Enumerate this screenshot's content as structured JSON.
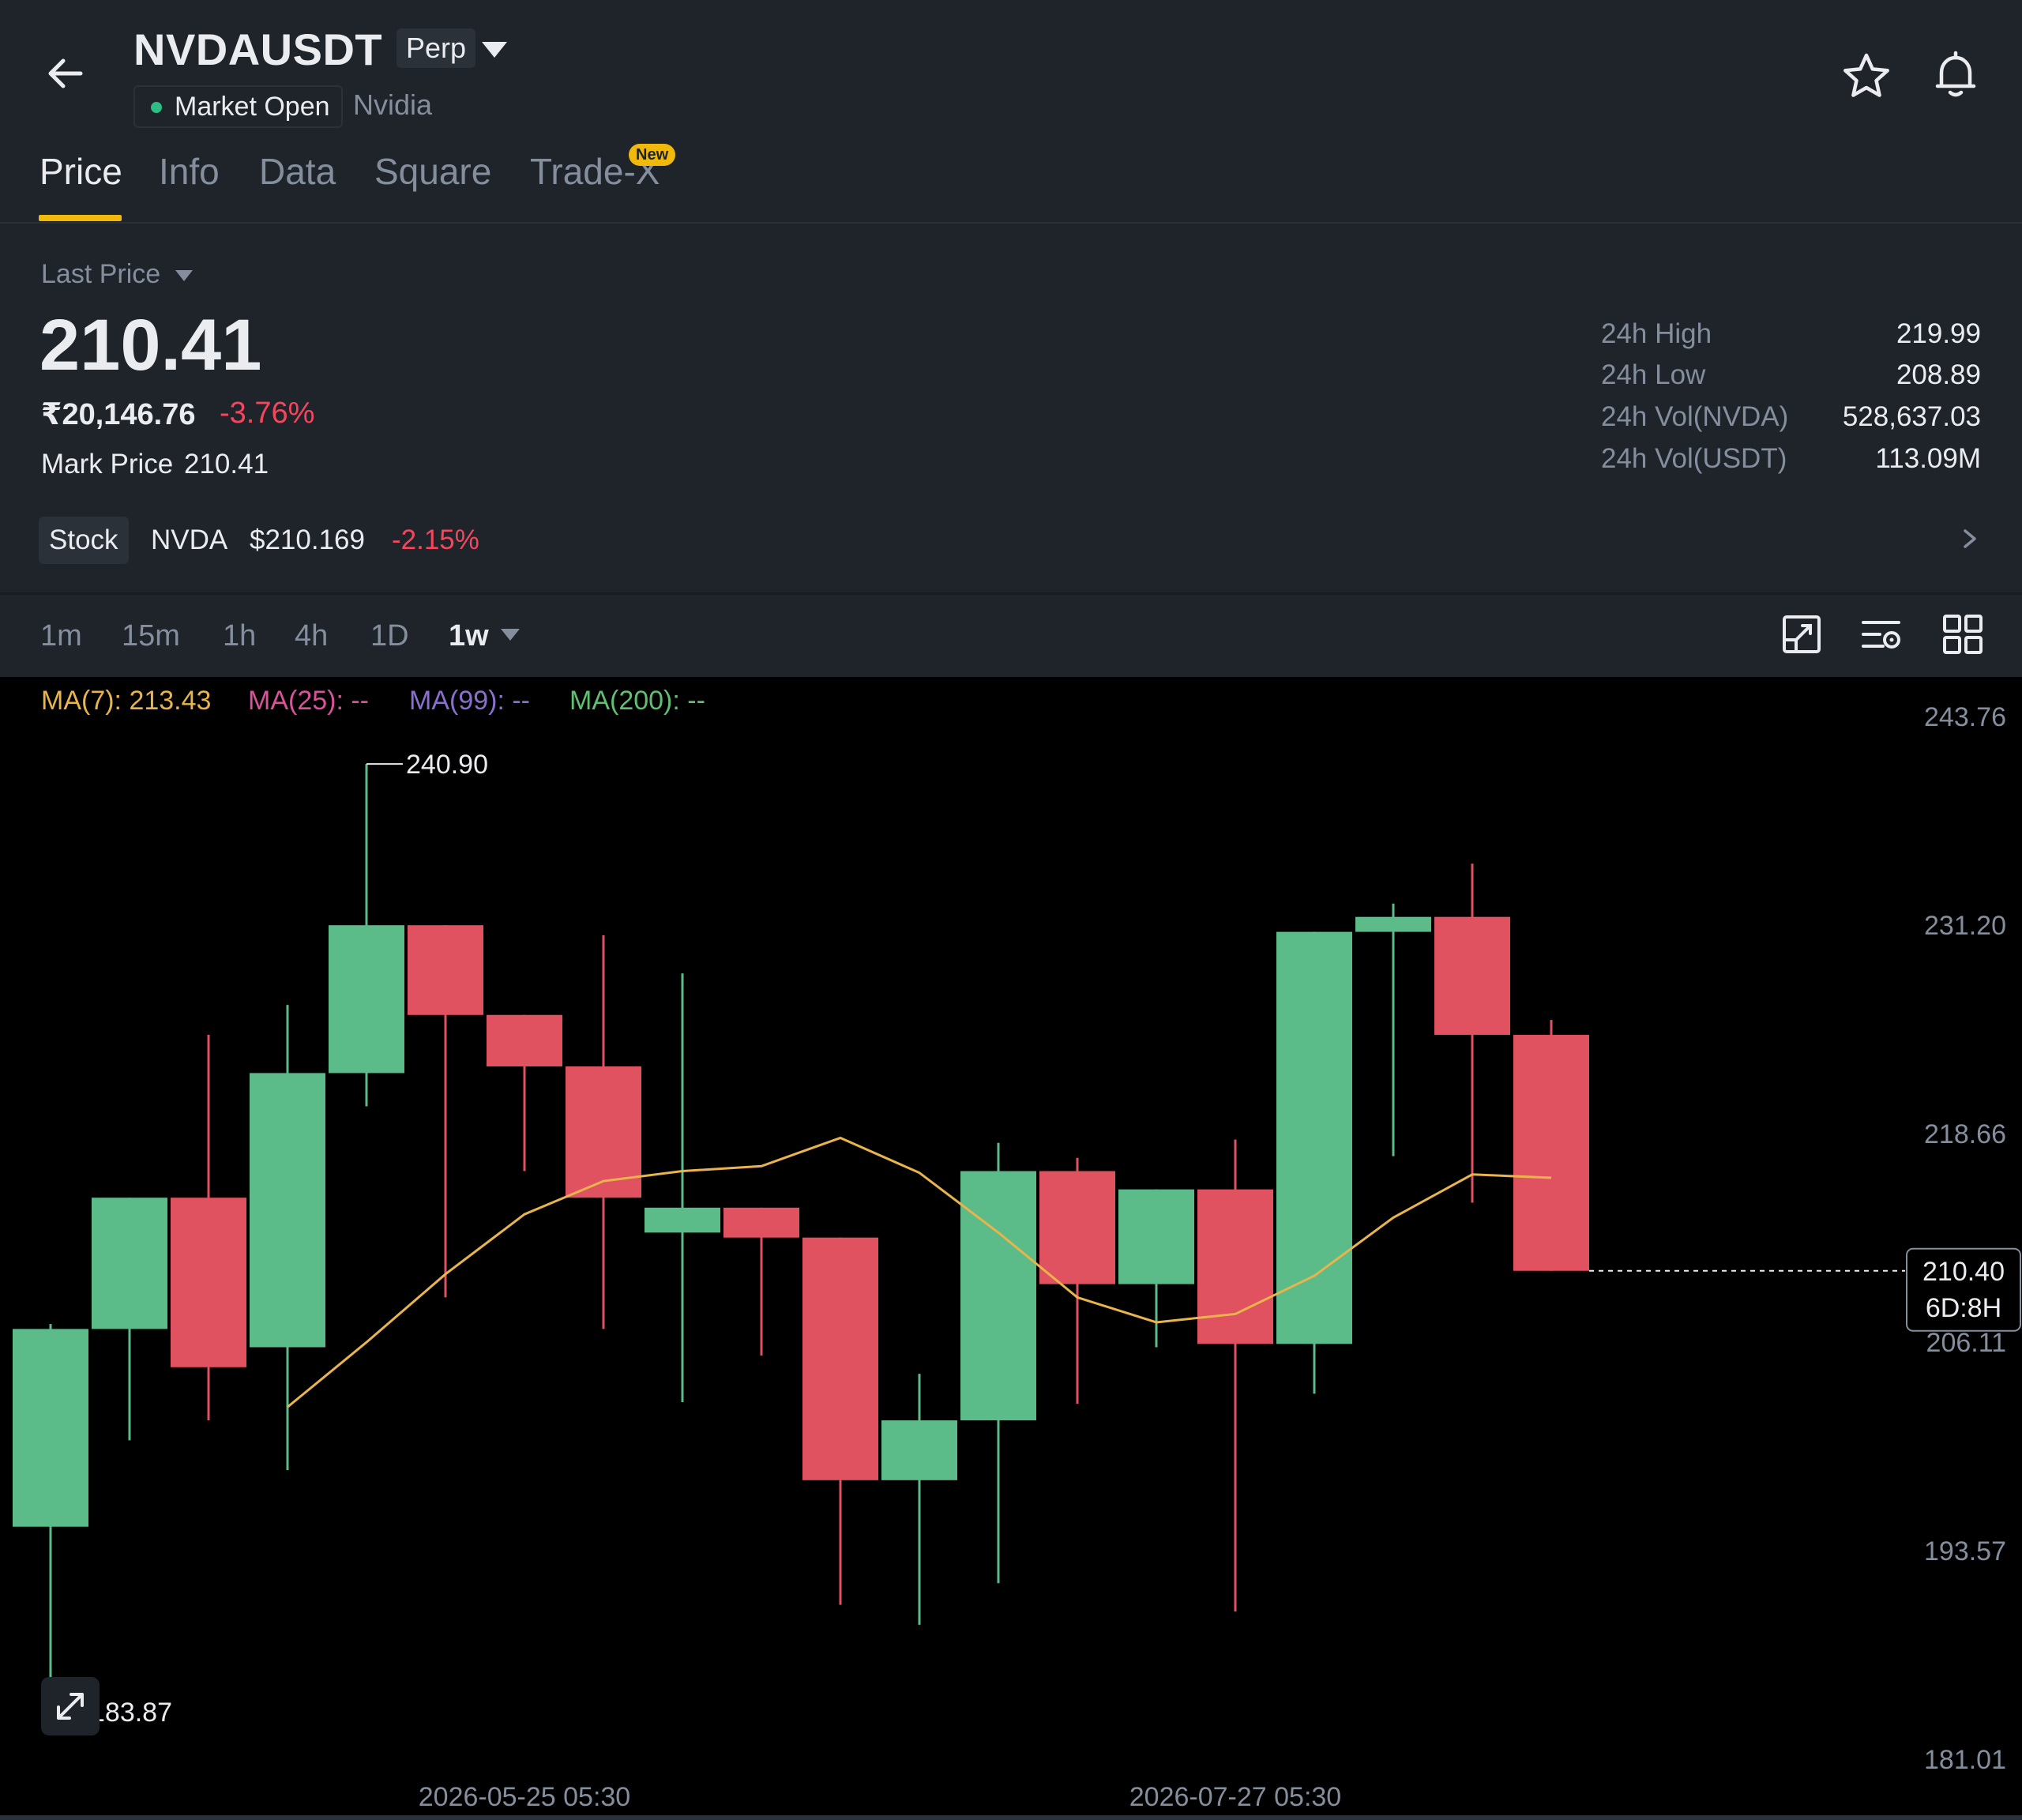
{
  "header": {
    "symbol": "NVDAUSDT",
    "contract_type": "Perp",
    "market_status": "Market Open",
    "company": "Nvidia",
    "icons": {
      "back": "back-arrow-icon",
      "favorite": "star-icon",
      "alert": "bell-icon",
      "dropdown": "caret-down-icon"
    }
  },
  "tabs": [
    {
      "label": "Price",
      "active": true
    },
    {
      "label": "Info",
      "active": false
    },
    {
      "label": "Data",
      "active": false
    },
    {
      "label": "Square",
      "active": false
    },
    {
      "label": "Trade-X",
      "active": false,
      "badge": "New"
    }
  ],
  "price": {
    "label": "Last Price",
    "last": "210.41",
    "inr": "₹20,146.76",
    "change_pct": "-3.76%",
    "mark_label": "Mark Price",
    "mark_value": "210.41"
  },
  "stats": [
    {
      "label": "24h High",
      "value": "219.99"
    },
    {
      "label": "24h Low",
      "value": "208.89"
    },
    {
      "label": "24h Vol(NVDA)",
      "value": "528,637.03"
    },
    {
      "label": "24h Vol(USDT)",
      "value": "113.09M"
    }
  ],
  "stock": {
    "tag": "Stock",
    "ticker": "NVDA",
    "price": "$210.169",
    "change": "-2.15%"
  },
  "intervals": [
    "1m",
    "15m",
    "1h",
    "4h",
    "1D",
    "1w"
  ],
  "active_interval": "1w",
  "toolbar_icons": [
    "chart-fullscreen-icon",
    "chart-settings-icon",
    "grid-layout-icon"
  ],
  "colors": {
    "up": "#5bbb89",
    "down": "#e0525f",
    "accent": "#f0b90b",
    "ma7": "#e9b44c",
    "ma25": "#d9539a",
    "ma99": "#8a6fce",
    "ma200": "#5fbf73"
  },
  "ma_legend": [
    {
      "label": "MA(7): 213.43",
      "color": "#e9b44c"
    },
    {
      "label": "MA(25): --",
      "color": "#d9539a"
    },
    {
      "label": "MA(99): --",
      "color": "#8a6fce"
    },
    {
      "label": "MA(200): --",
      "color": "#5fbf73"
    }
  ],
  "chart_data": {
    "type": "candlestick",
    "y_ticks": [
      "243.76",
      "231.20",
      "218.66",
      "206.11",
      "193.57",
      "181.01"
    ],
    "x_ticks": [
      "2026-05-25 05:30",
      "2026-07-27 05:30"
    ],
    "ylim": [
      181.01,
      243.76
    ],
    "max_label": "240.90",
    "min_label": "183.87",
    "current_price_label": "210.40",
    "countdown_label": "6D:8H",
    "candles": [
      {
        "o": 195.0,
        "h": 207.2,
        "l": 183.9,
        "c": 206.9
      },
      {
        "o": 206.9,
        "h": 210.5,
        "l": 200.2,
        "c": 214.8
      },
      {
        "o": 214.8,
        "h": 224.6,
        "l": 201.4,
        "c": 204.6
      },
      {
        "o": 205.8,
        "h": 226.4,
        "l": 198.4,
        "c": 222.3
      },
      {
        "o": 222.3,
        "h": 240.9,
        "l": 220.3,
        "c": 231.2
      },
      {
        "o": 231.2,
        "h": 228.9,
        "l": 208.8,
        "c": 225.8
      },
      {
        "o": 225.8,
        "h": 225.7,
        "l": 216.4,
        "c": 222.7
      },
      {
        "o": 222.7,
        "h": 230.6,
        "l": 206.9,
        "c": 214.8
      },
      {
        "o": 212.7,
        "h": 228.3,
        "l": 202.5,
        "c": 214.2
      },
      {
        "o": 214.2,
        "h": 211.9,
        "l": 205.3,
        "c": 212.4
      },
      {
        "o": 212.4,
        "h": 210.8,
        "l": 190.3,
        "c": 197.8
      },
      {
        "o": 197.8,
        "h": 204.2,
        "l": 189.1,
        "c": 201.4
      },
      {
        "o": 201.4,
        "h": 218.1,
        "l": 191.6,
        "c": 216.4
      },
      {
        "o": 216.4,
        "h": 217.2,
        "l": 202.4,
        "c": 209.6
      },
      {
        "o": 209.6,
        "h": 211.2,
        "l": 205.8,
        "c": 215.3
      },
      {
        "o": 215.3,
        "h": 218.3,
        "l": 189.9,
        "c": 206.0
      },
      {
        "o": 206.0,
        "h": 223.9,
        "l": 203.0,
        "c": 230.8
      },
      {
        "o": 230.8,
        "h": 232.5,
        "l": 217.3,
        "c": 231.7
      },
      {
        "o": 231.7,
        "h": 234.9,
        "l": 214.5,
        "c": 224.6
      },
      {
        "o": 224.6,
        "h": 225.5,
        "l": 212.9,
        "c": 210.4
      }
    ],
    "ma7": [
      null,
      null,
      null,
      202.2,
      206.1,
      210.2,
      213.8,
      215.8,
      216.4,
      216.7,
      218.4,
      216.3,
      212.7,
      208.8,
      207.3,
      207.8,
      210.1,
      213.6,
      216.2,
      216.0
    ]
  }
}
